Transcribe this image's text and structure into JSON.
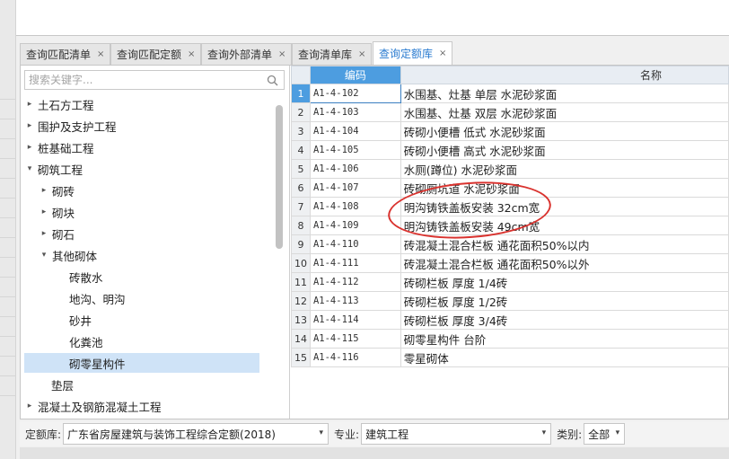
{
  "tabs": [
    {
      "label": "查询匹配清单",
      "active": false
    },
    {
      "label": "查询匹配定额",
      "active": false
    },
    {
      "label": "查询外部清单",
      "active": false
    },
    {
      "label": "查询清单库",
      "active": false
    },
    {
      "label": "查询定额库",
      "active": true
    }
  ],
  "tab_close_glyph": "×",
  "search": {
    "placeholder": "搜索关键字..."
  },
  "tree": [
    {
      "label": "土石方工程",
      "arrow": "▸"
    },
    {
      "label": "围护及支护工程",
      "arrow": "▸"
    },
    {
      "label": "桩基础工程",
      "arrow": "▸"
    },
    {
      "label": "砌筑工程",
      "arrow": "▾"
    },
    {
      "label": "砌砖",
      "arrow": "▸"
    },
    {
      "label": "砌块",
      "arrow": "▸"
    },
    {
      "label": "砌石",
      "arrow": "▸"
    },
    {
      "label": "其他砌体",
      "arrow": "▾"
    },
    {
      "label": "砖散水",
      "arrow": ""
    },
    {
      "label": "地沟、明沟",
      "arrow": ""
    },
    {
      "label": "砂井",
      "arrow": ""
    },
    {
      "label": "化粪池",
      "arrow": ""
    },
    {
      "label": "砌零星构件",
      "arrow": "",
      "selected": true
    },
    {
      "label": "垫层",
      "arrow": ""
    },
    {
      "label": "混凝土及钢筋混凝土工程",
      "arrow": "▸"
    }
  ],
  "table": {
    "headers": {
      "code": "编码",
      "name": "名称"
    },
    "rows": [
      {
        "num": "1",
        "code": "A1-4-102",
        "name": "水围基、灶基 单层 水泥砂浆面"
      },
      {
        "num": "2",
        "code": "A1-4-103",
        "name": "水围基、灶基 双层 水泥砂浆面"
      },
      {
        "num": "3",
        "code": "A1-4-104",
        "name": "砖砌小便槽 低式 水泥砂浆面"
      },
      {
        "num": "4",
        "code": "A1-4-105",
        "name": "砖砌小便槽 高式 水泥砂浆面"
      },
      {
        "num": "5",
        "code": "A1-4-106",
        "name": "水厕(蹲位) 水泥砂浆面"
      },
      {
        "num": "6",
        "code": "A1-4-107",
        "name": "砖砌厕坑道 水泥砂浆面"
      },
      {
        "num": "7",
        "code": "A1-4-108",
        "name": "明沟铸铁盖板安装 32cm宽"
      },
      {
        "num": "8",
        "code": "A1-4-109",
        "name": "明沟铸铁盖板安装 49cm宽"
      },
      {
        "num": "9",
        "code": "A1-4-110",
        "name": "砖混凝土混合栏板 通花面积50%以内"
      },
      {
        "num": "10",
        "code": "A1-4-111",
        "name": "砖混凝土混合栏板 通花面积50%以外"
      },
      {
        "num": "11",
        "code": "A1-4-112",
        "name": "砖砌栏板 厚度 1/4砖"
      },
      {
        "num": "12",
        "code": "A1-4-113",
        "name": "砖砌栏板 厚度 1/2砖"
      },
      {
        "num": "13",
        "code": "A1-4-114",
        "name": "砖砌栏板 厚度 3/4砖"
      },
      {
        "num": "14",
        "code": "A1-4-115",
        "name": "砌零星构件 台阶"
      },
      {
        "num": "15",
        "code": "A1-4-116",
        "name": "零星砌体"
      }
    ]
  },
  "bottom": {
    "quota_label": "定额库:",
    "quota_value": "广东省房屋建筑与装饰工程综合定额(2018)",
    "major_label": "专业:",
    "major_value": "建筑工程",
    "category_label": "类别:",
    "category_value": "全部",
    "caret": "▾"
  },
  "colors": {
    "accent": "#4d9de0",
    "annotation": "#d9322e",
    "selected_tree": "#cfe3f7"
  }
}
